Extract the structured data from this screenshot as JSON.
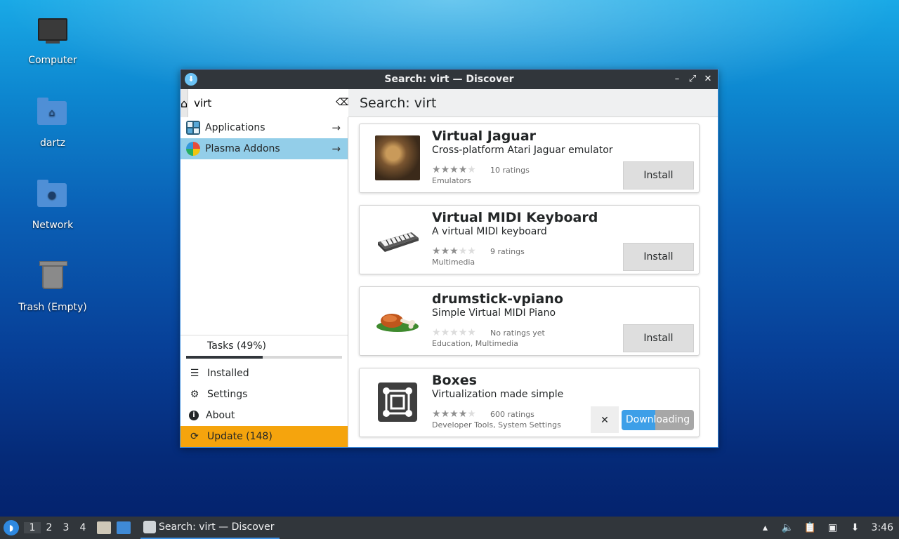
{
  "desktop": {
    "icons": [
      {
        "label": "Computer",
        "icon": "computer-icon"
      },
      {
        "label": "dartz",
        "icon": "home-folder-icon"
      },
      {
        "label": "Network",
        "icon": "network-folder-icon"
      },
      {
        "label": "Trash (Empty)",
        "icon": "trash-icon"
      }
    ]
  },
  "window": {
    "title": "Search: virt — Discover",
    "controls": {
      "minimize": "–",
      "maximize": "⤢",
      "close": "✕"
    }
  },
  "sidebar": {
    "search_value": "virt",
    "clear_glyph": "⌫",
    "home_glyph": "⌂",
    "categories": [
      {
        "label": "Applications",
        "icon": "applications-icon"
      },
      {
        "label": "Plasma Addons",
        "icon": "plasma-addons-icon",
        "selected": true
      }
    ],
    "arrow_glyph": "→",
    "tasks_label": "Tasks (49%)",
    "tasks_progress": 0.49,
    "nav": {
      "installed": "Installed",
      "settings": "Settings",
      "about": "About",
      "update": "Update (148)"
    }
  },
  "main": {
    "header": "Search: virt",
    "results": [
      {
        "name": "Virtual Jaguar",
        "summary": "Cross-platform Atari Jaguar emulator",
        "rating_stars": 4,
        "ratings_label": "10 ratings",
        "categories": "Emulators",
        "action": "Install",
        "thumb": "jaguar-thumbnail"
      },
      {
        "name": "Virtual MIDI Keyboard",
        "summary": "A virtual MIDI keyboard",
        "rating_stars": 3,
        "ratings_label": "9 ratings",
        "categories": "Multimedia",
        "action": "Install",
        "thumb": "midi-keyboard-thumbnail"
      },
      {
        "name": "drumstick-vpiano",
        "summary": "Simple Virtual MIDI Piano",
        "rating_stars": 0,
        "ratings_label": "No ratings yet",
        "categories": "Education, Multimedia",
        "action": "Install",
        "thumb": "drumstick-thumbnail"
      },
      {
        "name": "Boxes",
        "summary": "Virtualization made simple",
        "rating_stars": 4,
        "ratings_label": "600 ratings",
        "categories": "Developer Tools, System Settings",
        "action": "Downloading",
        "cancel_glyph": "✕",
        "download_progress": 0.47,
        "thumb": "boxes-thumbnail"
      }
    ]
  },
  "taskbar": {
    "workspaces": [
      "1",
      "2",
      "3",
      "4"
    ],
    "active_workspace": "1",
    "task_title": "Search: virt — Discover",
    "clock": "3:46"
  },
  "colors": {
    "accent": "#3d8ee0",
    "selection": "#93cee9",
    "update": "#f5a40d",
    "titlebar": "#31363b",
    "download": "#3d9fe8"
  }
}
